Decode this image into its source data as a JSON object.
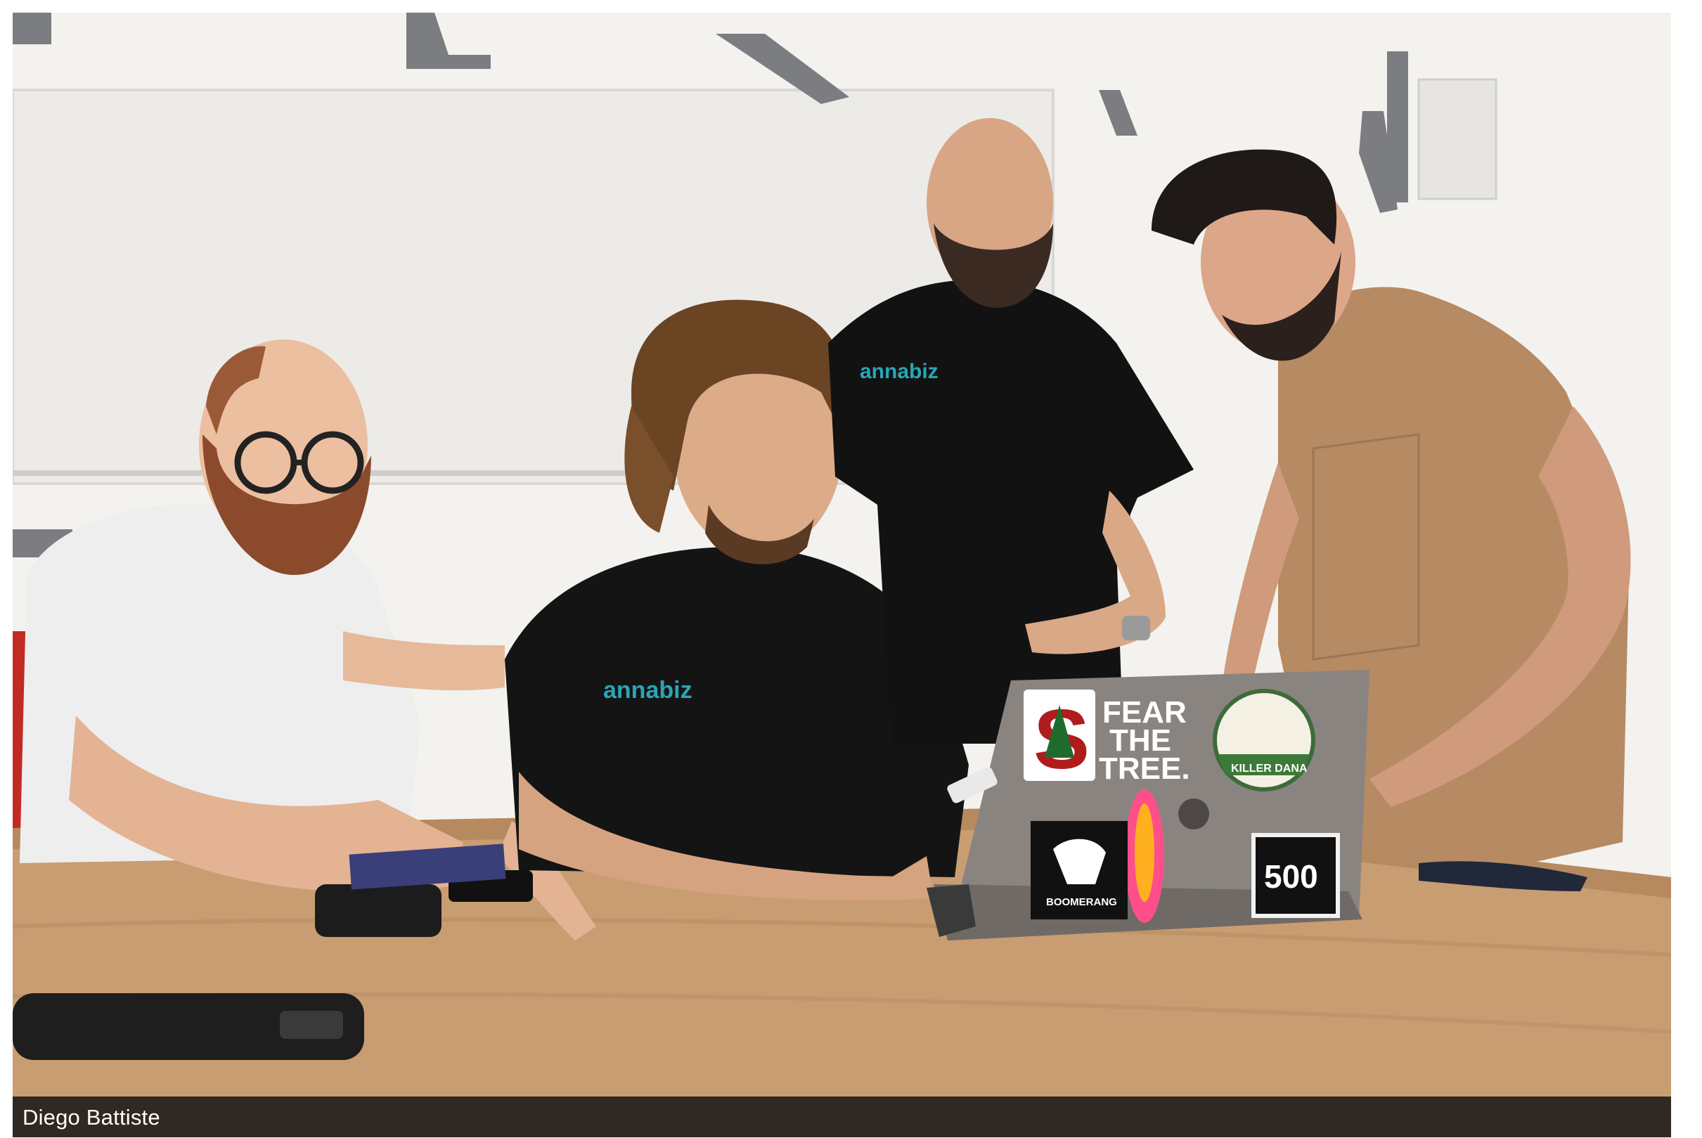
{
  "caption": {
    "credit": "Diego Battiste"
  },
  "photo": {
    "subject": "four men gathered around a laptop on a wooden conference table",
    "stickers": {
      "stanford_letter": "S",
      "fear_line1": "FEAR",
      "fear_line2": "THE",
      "fear_line3": "TREE.",
      "badge_500": "500",
      "killer_dana": "KILLER DANA",
      "boomerang": "BOOMERANG"
    },
    "shirt_logo": "annabiz"
  },
  "colors": {
    "wall": "#f2f1ee",
    "table": "#c99d72",
    "caption_bar": "#2f2823",
    "shirt_black": "#141414",
    "shirt_tan": "#b68a62",
    "laptop": "#8a8480"
  }
}
